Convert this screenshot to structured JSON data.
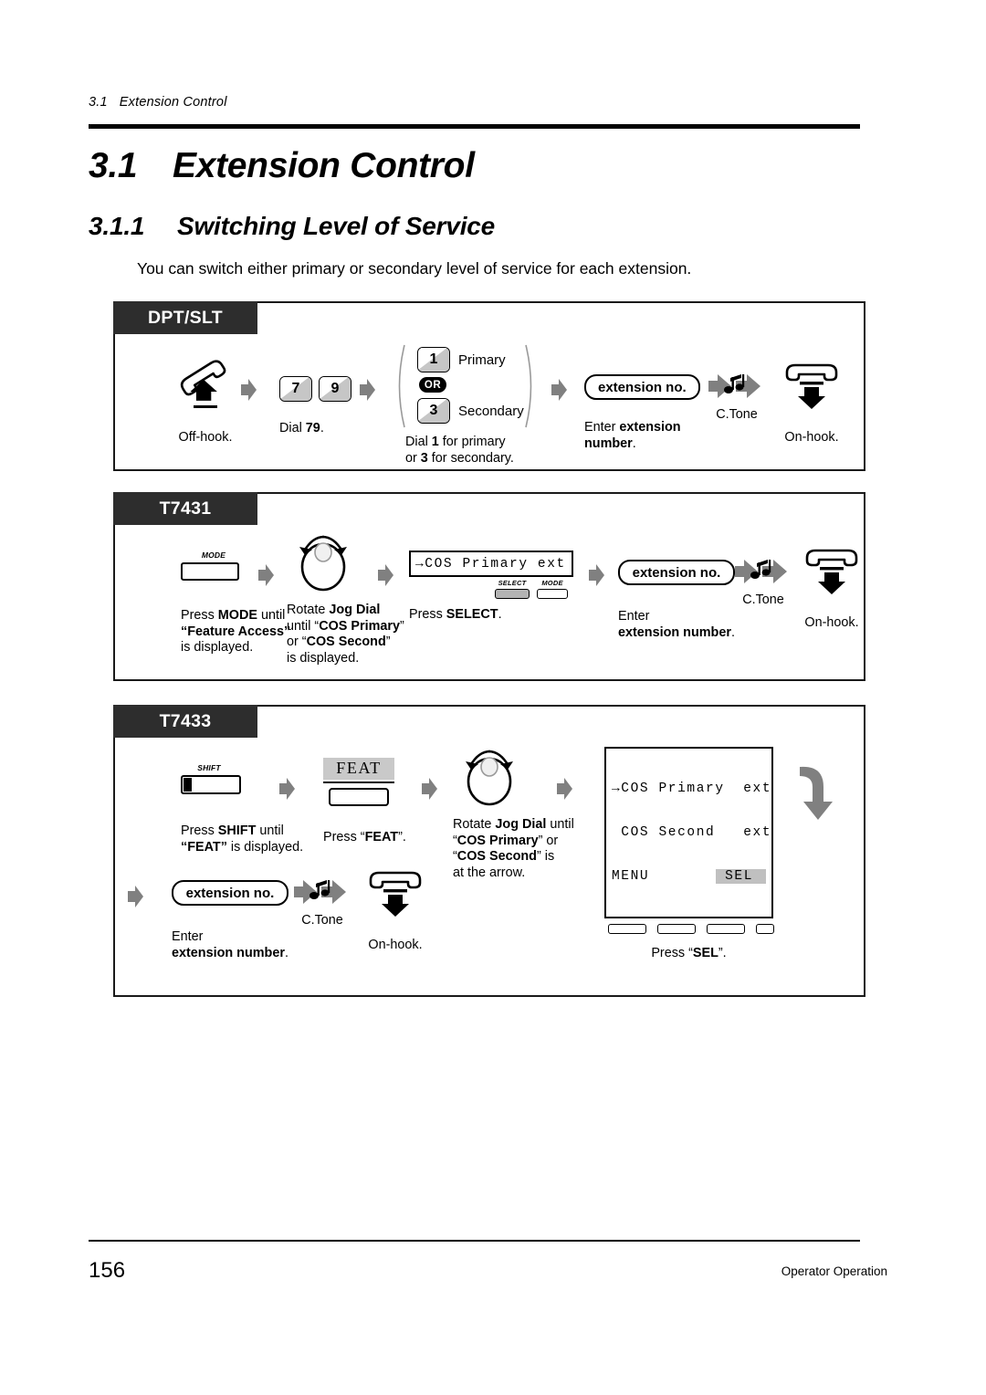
{
  "runhead": {
    "number": "3.1",
    "title": "Extension Control"
  },
  "headings": {
    "h1_number": "3.1",
    "h1_title": "Extension Control",
    "h2_number": "3.1.1",
    "h2_title": "Switching Level of Service"
  },
  "intro": "You can switch either primary or secondary level of service for each extension.",
  "panels": {
    "dpt_slt": {
      "tab": "DPT/SLT",
      "steps": {
        "offhook_caption": "Off-hook.",
        "dial_caption_pre": "Dial ",
        "dial_caption_bold": "79",
        "dial_caption_post": ".",
        "key_7": "7",
        "key_9": "9",
        "or_label": "OR",
        "key_1": "1",
        "key_1_label": "Primary",
        "key_3": "3",
        "key_3_label": "Secondary",
        "choice_caption_line1_a": "Dial ",
        "choice_caption_line1_b": "1",
        "choice_caption_line1_c": " for primary",
        "choice_caption_line2_a": "or ",
        "choice_caption_line2_b": "3",
        "choice_caption_line2_c": " for secondary.",
        "extension_pill": "extension no.",
        "enter_caption_a": "Enter ",
        "enter_caption_b": "extension",
        "enter_caption_c": "number",
        "enter_caption_d": ".",
        "ctone": "C.Tone",
        "onhook_caption": "On-hook."
      }
    },
    "t7431": {
      "tab": "T7431",
      "steps": {
        "mode_button": "MODE",
        "mode_caption_a": "Press ",
        "mode_caption_b": "MODE",
        "mode_caption_c": " until",
        "mode_caption_d": "“Feature Access”",
        "mode_caption_e": "is displayed.",
        "jog_caption_a": "Rotate ",
        "jog_caption_b": "Jog Dial",
        "jog_caption_c": "until “",
        "jog_caption_d": "COS Primary",
        "jog_caption_e": "”",
        "jog_caption_f": "or “",
        "jog_caption_g": "COS Second",
        "jog_caption_h": "”",
        "jog_caption_i": "is displayed.",
        "lcd_text": "→COS Primary ext",
        "soft_select": "SELECT",
        "soft_mode": "MODE",
        "select_caption_a": "Press ",
        "select_caption_b": "SELECT",
        "select_caption_c": ".",
        "extension_pill": "extension no.",
        "enter_caption_a": "Enter",
        "enter_caption_b": "extension number",
        "enter_caption_c": ".",
        "ctone": "C.Tone",
        "onhook_caption": "On-hook."
      }
    },
    "t7433": {
      "tab": "T7433",
      "steps": {
        "shift_button": "SHIFT",
        "shift_caption_a": "Press ",
        "shift_caption_b": "SHIFT",
        "shift_caption_c": " until",
        "shift_caption_d": "“FEAT”",
        "shift_caption_e": " is displayed.",
        "feat_label": "FEAT",
        "feat_caption_a": "Press “",
        "feat_caption_b": "FEAT",
        "feat_caption_c": "”.",
        "jog_caption_a": "Rotate ",
        "jog_caption_b": "Jog Dial",
        "jog_caption_c": " until",
        "jog_caption_d": "“",
        "jog_caption_e": "COS Primary",
        "jog_caption_f": "” or",
        "jog_caption_g": "“",
        "jog_caption_h": "COS Second",
        "jog_caption_i": "” is",
        "jog_caption_j": "at the arrow.",
        "lcd_line1": "→COS Primary  ext",
        "lcd_line2": " COS Second   ext",
        "lcd_line3_left": "MENU",
        "lcd_line3_right": "SEL",
        "sel_caption_a": "Press “",
        "sel_caption_b": "SEL",
        "sel_caption_c": "”.",
        "extension_pill": "extension no.",
        "enter_caption_a": "Enter",
        "enter_caption_b": "extension number",
        "enter_caption_c": ".",
        "ctone": "C.Tone",
        "onhook_caption": "On-hook."
      }
    }
  },
  "footer": {
    "page_number": "156",
    "doc_title": "Operator Operation"
  },
  "colors": {
    "tab_background": "#2d2d2d",
    "arrow_gray": "#808080",
    "key_shade": "#c6c6c6",
    "softkey_fill": "#b3b3b3"
  }
}
